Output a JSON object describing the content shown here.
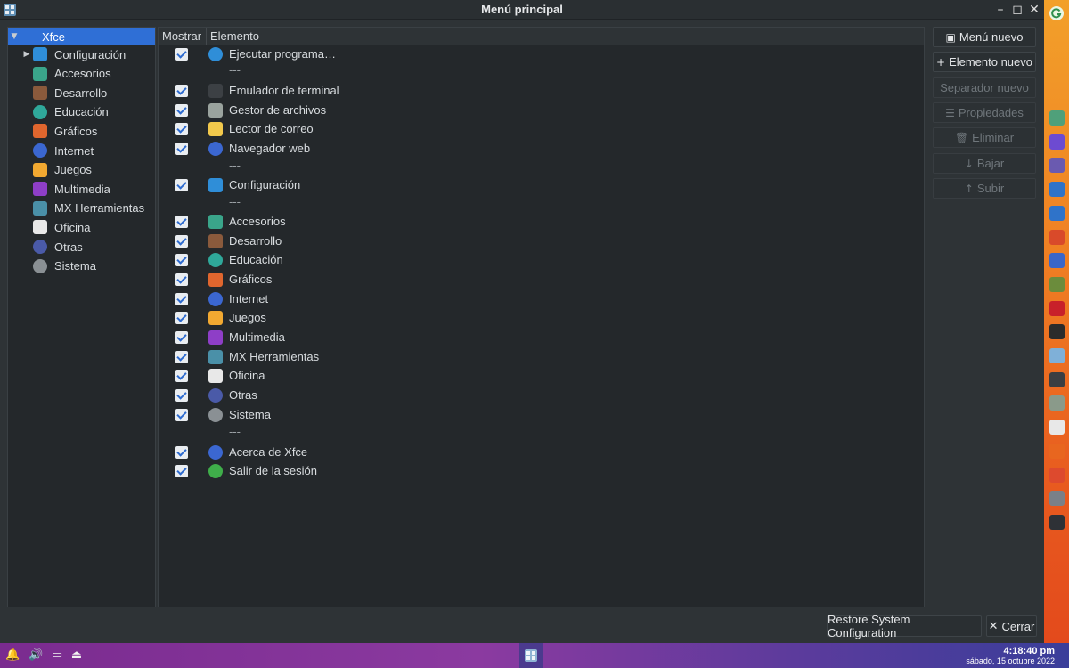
{
  "window": {
    "title": "Menú principal",
    "controls": {
      "minimize": "–",
      "maximize": "◻",
      "close": "✕"
    }
  },
  "tree": {
    "root": "Xfce",
    "items": [
      {
        "label": "Configuración",
        "icon": "settings-icon",
        "color": "#2f8ed8",
        "expandable": true
      },
      {
        "label": "Accesorios",
        "icon": "accessories-icon",
        "color": "#3aa58a"
      },
      {
        "label": "Desarrollo",
        "icon": "development-icon",
        "color": "#8a5a3c"
      },
      {
        "label": "Educación",
        "icon": "education-icon",
        "color": "#2fa89a"
      },
      {
        "label": "Gráficos",
        "icon": "graphics-icon",
        "color": "#e0662e"
      },
      {
        "label": "Internet",
        "icon": "internet-icon",
        "color": "#3b67d1"
      },
      {
        "label": "Juegos",
        "icon": "games-icon",
        "color": "#f2a931"
      },
      {
        "label": "Multimedia",
        "icon": "multimedia-icon",
        "color": "#8e3ec7"
      },
      {
        "label": "MX Herramientas",
        "icon": "mx-tools-icon",
        "color": "#4a90a8"
      },
      {
        "label": "Oficina",
        "icon": "office-icon",
        "color": "#e8e8e8"
      },
      {
        "label": "Otras",
        "icon": "other-icon",
        "color": "#4a5aa8"
      },
      {
        "label": "Sistema",
        "icon": "system-icon",
        "color": "#8a9094"
      }
    ]
  },
  "list": {
    "headers": {
      "show": "Mostrar",
      "element": "Elemento"
    },
    "separator_text": "---",
    "rows": [
      {
        "type": "item",
        "label": "Ejecutar programa…",
        "icon": "run-icon",
        "color": "#2f8ed8"
      },
      {
        "type": "separator"
      },
      {
        "type": "item",
        "label": "Emulador de terminal",
        "icon": "terminal-icon",
        "color": "#3c4044"
      },
      {
        "type": "item",
        "label": "Gestor de archivos",
        "icon": "file-manager-icon",
        "color": "#9aa39e"
      },
      {
        "type": "item",
        "label": "Lector de correo",
        "icon": "mail-icon",
        "color": "#f2c94c"
      },
      {
        "type": "item",
        "label": "Navegador web",
        "icon": "browser-icon",
        "color": "#3b67d1"
      },
      {
        "type": "separator"
      },
      {
        "type": "item",
        "label": "Configuración",
        "icon": "settings-icon",
        "color": "#2f8ed8"
      },
      {
        "type": "separator"
      },
      {
        "type": "item",
        "label": "Accesorios",
        "icon": "accessories-icon",
        "color": "#3aa58a"
      },
      {
        "type": "item",
        "label": "Desarrollo",
        "icon": "development-icon",
        "color": "#8a5a3c"
      },
      {
        "type": "item",
        "label": "Educación",
        "icon": "education-icon",
        "color": "#2fa89a"
      },
      {
        "type": "item",
        "label": "Gráficos",
        "icon": "graphics-icon",
        "color": "#e0662e"
      },
      {
        "type": "item",
        "label": "Internet",
        "icon": "internet-icon",
        "color": "#3b67d1"
      },
      {
        "type": "item",
        "label": "Juegos",
        "icon": "games-icon",
        "color": "#f2a931"
      },
      {
        "type": "item",
        "label": "Multimedia",
        "icon": "multimedia-icon",
        "color": "#8e3ec7"
      },
      {
        "type": "item",
        "label": "MX Herramientas",
        "icon": "mx-tools-icon",
        "color": "#4a90a8"
      },
      {
        "type": "item",
        "label": "Oficina",
        "icon": "office-icon",
        "color": "#e8e8e8"
      },
      {
        "type": "item",
        "label": "Otras",
        "icon": "other-icon",
        "color": "#4a5aa8"
      },
      {
        "type": "item",
        "label": "Sistema",
        "icon": "system-icon",
        "color": "#8a9094"
      },
      {
        "type": "separator"
      },
      {
        "type": "item",
        "label": "Acerca de Xfce",
        "icon": "about-icon",
        "color": "#3b67d1"
      },
      {
        "type": "item",
        "label": "Salir de la sesión",
        "icon": "logout-icon",
        "color": "#3fae4a"
      }
    ]
  },
  "actions": [
    {
      "label": "Menú nuevo",
      "glyph": "▣",
      "enabled": true
    },
    {
      "label": "Elemento nuevo",
      "glyph": "+",
      "enabled": true
    },
    {
      "label": "Separador nuevo",
      "glyph": "",
      "enabled": false
    },
    {
      "label": "Propiedades",
      "glyph": "☰",
      "enabled": false
    },
    {
      "label": "Eliminar",
      "glyph": "🗑",
      "enabled": false
    },
    {
      "label": "Bajar",
      "glyph": "↓",
      "enabled": false
    },
    {
      "label": "Subir",
      "glyph": "↑",
      "enabled": false
    }
  ],
  "footer": {
    "restore": "Restore System Configuration",
    "close": "Cerrar",
    "close_glyph": "✕"
  },
  "taskbar": {
    "time": "4:18:40 pm",
    "date": "sábado, 15 octubre 2022"
  },
  "dock_colors": [
    "#2e3136",
    "#4fa07a",
    "#6d4bd1",
    "#6a5ab0",
    "#2f73c9",
    "#2f73c9",
    "#d94a2a",
    "#3a66c9",
    "#6b8c3c",
    "#c8202a",
    "#2b2b2b",
    "#7fb0d8",
    "#3a3e42",
    "#8a9a8a",
    "#e8e8e8",
    "#e8661f",
    "#dd4a2e",
    "#7a8088",
    "#2e3136"
  ]
}
